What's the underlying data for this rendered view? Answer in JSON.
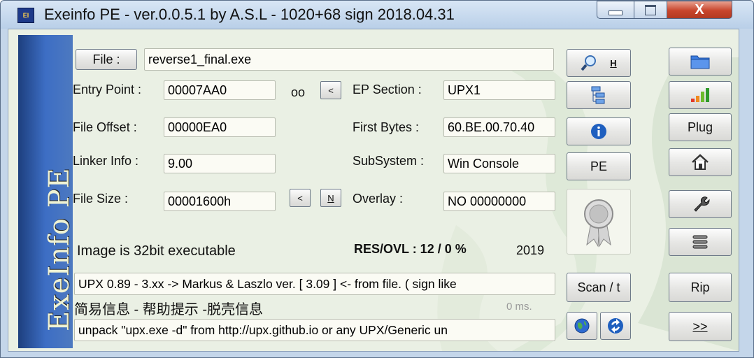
{
  "window": {
    "title": "Exeinfo PE - ver.0.0.5.1  by A.S.L -  1020+68 sign  2018.04.31",
    "close_glyph": "X"
  },
  "banner": {
    "text": "ExeInfo PE"
  },
  "file": {
    "button": "File :",
    "button_hotkey_char": "F",
    "path": "reverse1_final.exe"
  },
  "fields": {
    "entry_point_label": "Entry Point :",
    "entry_point_value": "00007AA0",
    "oo_label": "oo",
    "lt_label": "<",
    "ep_section_label": "EP Section :",
    "ep_section_value": "UPX1",
    "file_offset_label": "File Offset :",
    "file_offset_value": "00000EA0",
    "first_bytes_label": "First Bytes :",
    "first_bytes_value": "60.BE.00.70.40",
    "linker_info_label": "Linker Info :",
    "linker_info_value": "9.00",
    "subsystem_label": "SubSystem :",
    "subsystem_value": "Win Console",
    "file_size_label": "File Size :",
    "file_size_value": "00001600h",
    "size_lt_label": "<",
    "size_n_label": "N",
    "overlay_label": "Overlay :",
    "overlay_value": "NO   00000000"
  },
  "status": {
    "image_info": "Image is 32bit executable",
    "res_ovl": "RES/OVL : 12 / 0 %",
    "year": "2019",
    "detection": "UPX 0.89 - 3.xx -> Markus & Laszlo ver. [ 3.09 ] <- from file. ( sign like",
    "chinese_label": "简易信息 - 帮助提示 -脱壳信息",
    "time": "0 ms.",
    "hint": "unpack \"upx.exe -d\"  from  http://upx.github.io or any UPX/Generic un"
  },
  "middle_buttons": {
    "search_hotkey": "H",
    "pe": "PE",
    "scan": "Scan / t"
  },
  "right_buttons": {
    "plug": "Plug",
    "rip": "Rip",
    "next": ">>"
  },
  "colors": {
    "accent": "#1f5fbf",
    "banner": "#2f5fae",
    "close": "#c8452c"
  }
}
